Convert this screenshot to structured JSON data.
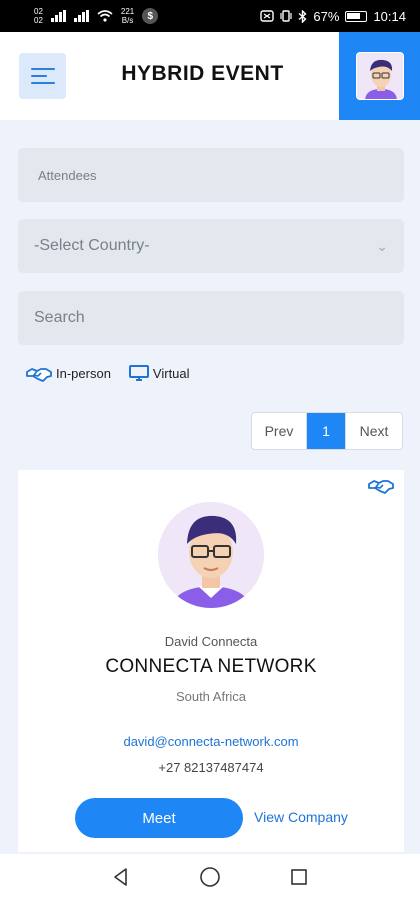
{
  "status_bar": {
    "sim_top": "02",
    "sim_bottom": "02",
    "speed_top": "221",
    "speed_bottom": "B/s",
    "dollar": "$",
    "battery": "67%",
    "time": "10:14"
  },
  "header": {
    "title": "HYBRID EVENT"
  },
  "form": {
    "attendees_label": "Attendees",
    "country_value": "-Select Country-",
    "search_placeholder": "Search"
  },
  "filters": {
    "in_person": "In-person",
    "virtual": "Virtual"
  },
  "pagination": {
    "prev": "Prev",
    "current": "1",
    "next": "Next"
  },
  "card": {
    "name": "David Connecta",
    "company": "CONNECTA NETWORK",
    "country": "South Africa",
    "email": "david@connecta-network.com",
    "phone": "+27 82137487474",
    "meet_label": "Meet",
    "view_company_label": "View Company"
  },
  "colors": {
    "accent": "#1e87f5",
    "background": "#eef3fb",
    "field": "#e3e8ef"
  }
}
